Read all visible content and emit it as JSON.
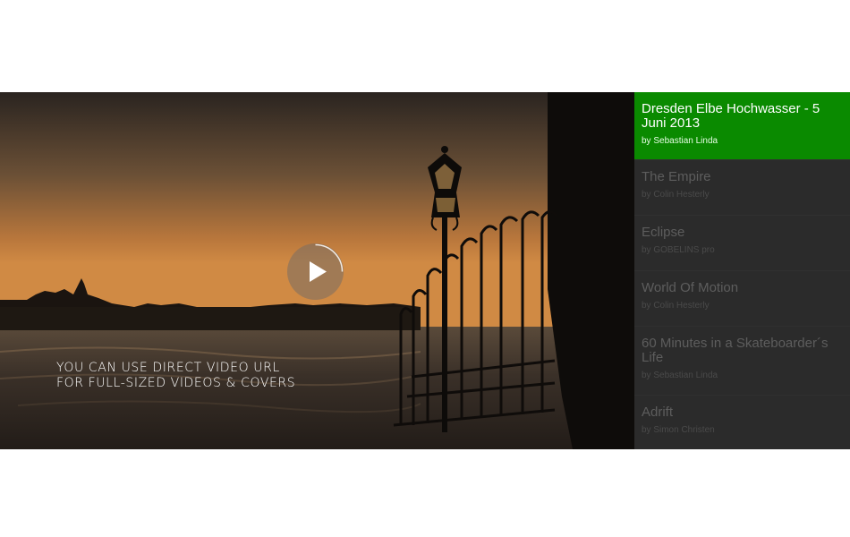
{
  "player": {
    "caption_line1": "You can use direct video URL",
    "caption_line2": "for full-sized videos & covers",
    "play_icon": "play-icon"
  },
  "playlist": {
    "items": [
      {
        "title": "Dresden Elbe Hochwasser - 5 Juni 2013",
        "author": "by Sebastian Linda",
        "active": true
      },
      {
        "title": "The Empire",
        "author": "by Colin Hesterly"
      },
      {
        "title": "Eclipse",
        "author": "by GOBELINS pro"
      },
      {
        "title": "World Of Motion",
        "author": "by Colin Hesterly"
      },
      {
        "title": "60 Minutes in a Skateboarder´s Life",
        "author": "by Sebastian Linda"
      },
      {
        "title": "Adrift",
        "author": "by Simon Christen"
      }
    ]
  },
  "colors": {
    "active_item": "#0a8a00",
    "playlist_bg": "#2b2b2b"
  }
}
